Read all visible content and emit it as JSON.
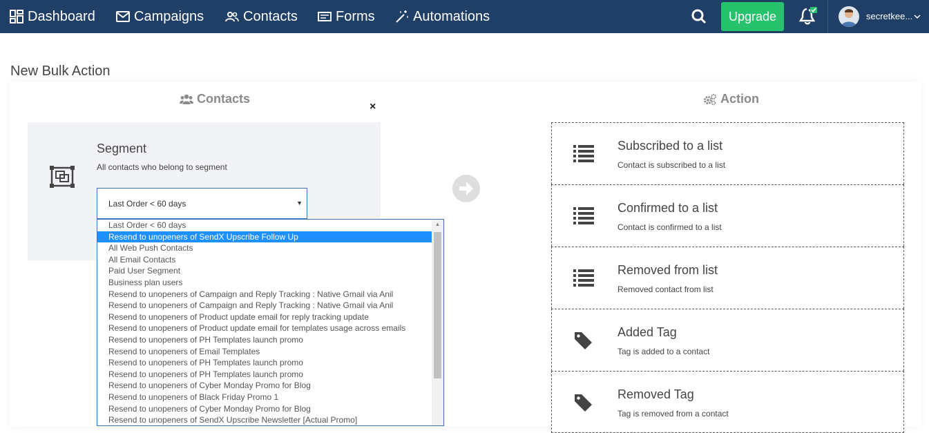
{
  "nav": {
    "dashboard": "Dashboard",
    "campaigns": "Campaigns",
    "contacts": "Contacts",
    "forms": "Forms",
    "automations": "Automations",
    "upgrade": "Upgrade",
    "username": "secretkee..."
  },
  "page": {
    "title": "New Bulk Action"
  },
  "contacts_panel": {
    "heading": "Contacts",
    "close": "×",
    "segment_title": "Segment",
    "segment_desc": "All contacts who belong to segment",
    "selected_value": "Last Order < 60 days",
    "options": [
      "Last Order < 60 days",
      "Resend to unopeners of SendX Upscribe Follow Up",
      "All Web Push Contacts",
      "All Email Contacts",
      "Paid User Segment",
      "Business plan users",
      "Resend to unopeners of Campaign and Reply Tracking : Native Gmail via Anil",
      "Resend to unopeners of Campaign and Reply Tracking : Native Gmail via Anil",
      "Resend to unopeners of Product update email for reply tracking update",
      "Resend to unopeners of Product update email for templates usage across emails",
      "Resend to unopeners of PH Templates launch promo",
      "Resend to unopeners of Email Templates",
      "Resend to unopeners of PH Templates launch promo",
      "Resend to unopeners of PH Templates launch promo",
      "Resend to unopeners of Cyber Monday Promo for Blog",
      "Resend to unopeners of Black Friday Promo 1",
      "Resend to unopeners of Cyber Monday Promo for Blog",
      "Resend to unopeners of SendX Upscribe Newsletter [Actual Promo]"
    ],
    "highlighted_index": 1
  },
  "action_panel": {
    "heading": "Action",
    "items": [
      {
        "title": "Subscribed to a list",
        "desc": "Contact is subscribed to a list",
        "icon": "list-icon"
      },
      {
        "title": "Confirmed to a list",
        "desc": "Contact is confirmed to a list",
        "icon": "list-icon"
      },
      {
        "title": "Removed from list",
        "desc": "Removed contact from list",
        "icon": "list-icon"
      },
      {
        "title": "Added Tag",
        "desc": "Tag is added to a contact",
        "icon": "tag-icon"
      },
      {
        "title": "Removed Tag",
        "desc": "Tag is removed from a contact",
        "icon": "tag-icon"
      }
    ]
  },
  "colors": {
    "navbar": "#1f3f66",
    "upgrade": "#27c26c",
    "highlight": "#1e90ff"
  }
}
